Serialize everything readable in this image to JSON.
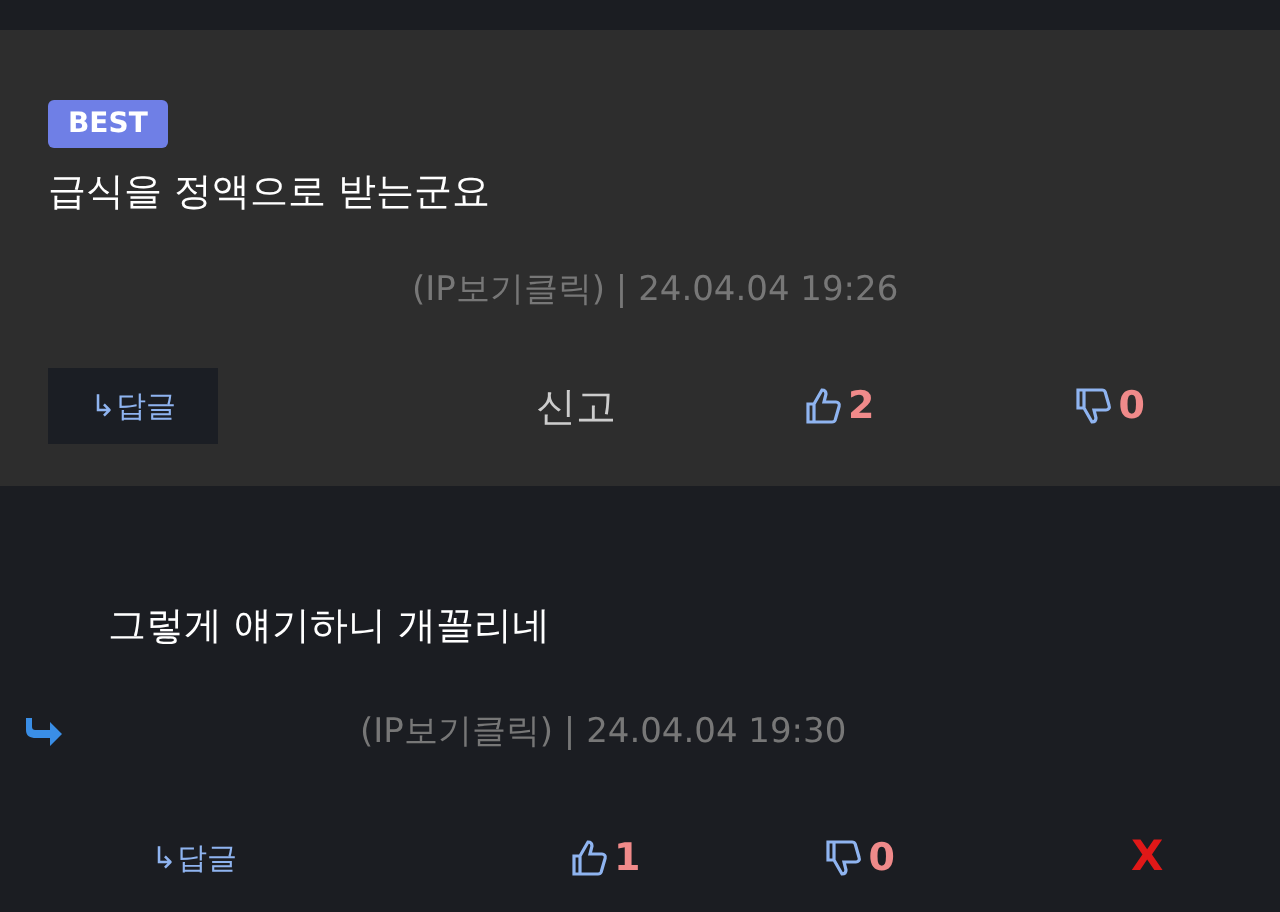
{
  "comments": [
    {
      "kind": "best",
      "badge": "BEST",
      "text": "급식을 정액으로 받는군요",
      "meta": "(IP보기클릭) | 24.04.04 19:26",
      "reply_button": "↳답글",
      "report": "신고",
      "likes": "2",
      "dislikes": "0"
    },
    {
      "kind": "reply",
      "text": "그렇게 얘기하니 개꼴리네",
      "meta": "(IP보기클릭) | 24.04.04 19:30",
      "reply_button": "↳답글",
      "likes": "1",
      "dislikes": "0",
      "delete": "X"
    }
  ]
}
